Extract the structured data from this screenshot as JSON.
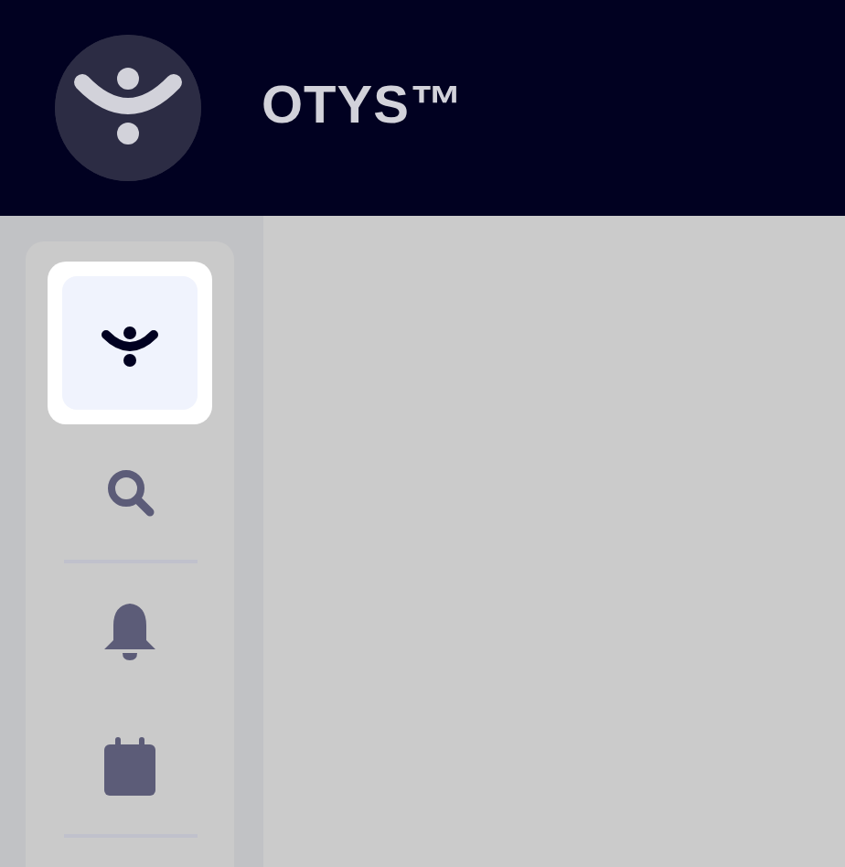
{
  "header": {
    "title": "OTYS™"
  },
  "sidebar": {
    "items": [
      {
        "kind": "button",
        "selected": true
      },
      {
        "kind": "button",
        "selected": false
      },
      {
        "kind": "divider"
      },
      {
        "kind": "button",
        "selected": false
      },
      {
        "kind": "button",
        "selected": false
      },
      {
        "kind": "divider"
      }
    ]
  }
}
